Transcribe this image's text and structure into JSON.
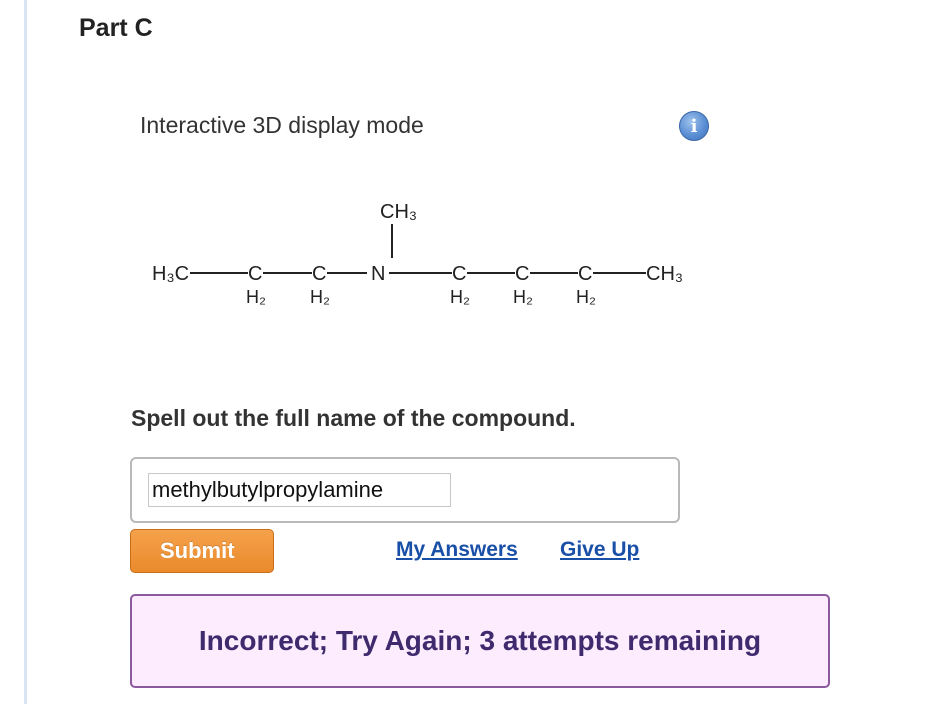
{
  "part": {
    "title": "Part C"
  },
  "display": {
    "mode_label": "Interactive 3D display mode",
    "info_icon": "info-icon",
    "info_glyph": "i"
  },
  "molecule": {
    "left_terminal": "H₃C",
    "chain_atoms_left": [
      "C",
      "C"
    ],
    "center_atom": "N",
    "branch_group": "CH₃",
    "chain_atoms_right": [
      "C",
      "C",
      "C"
    ],
    "right_terminal": "CH₃",
    "hydrogen_label": "H₂"
  },
  "question": {
    "prompt": "Spell out the full name of the compound."
  },
  "answer": {
    "value": "methylbutylpropylamine",
    "placeholder": ""
  },
  "actions": {
    "submit_label": "Submit",
    "my_answers_label": "My Answers",
    "give_up_label": "Give Up"
  },
  "feedback": {
    "message": "Incorrect; Try Again; 3 attempts remaining"
  },
  "colors": {
    "submit": "#ea8a2c",
    "link": "#1a4fa8",
    "feedback_bg": "#fcecfd",
    "feedback_border": "#8b5a9e",
    "feedback_text": "#3f2a6e"
  }
}
